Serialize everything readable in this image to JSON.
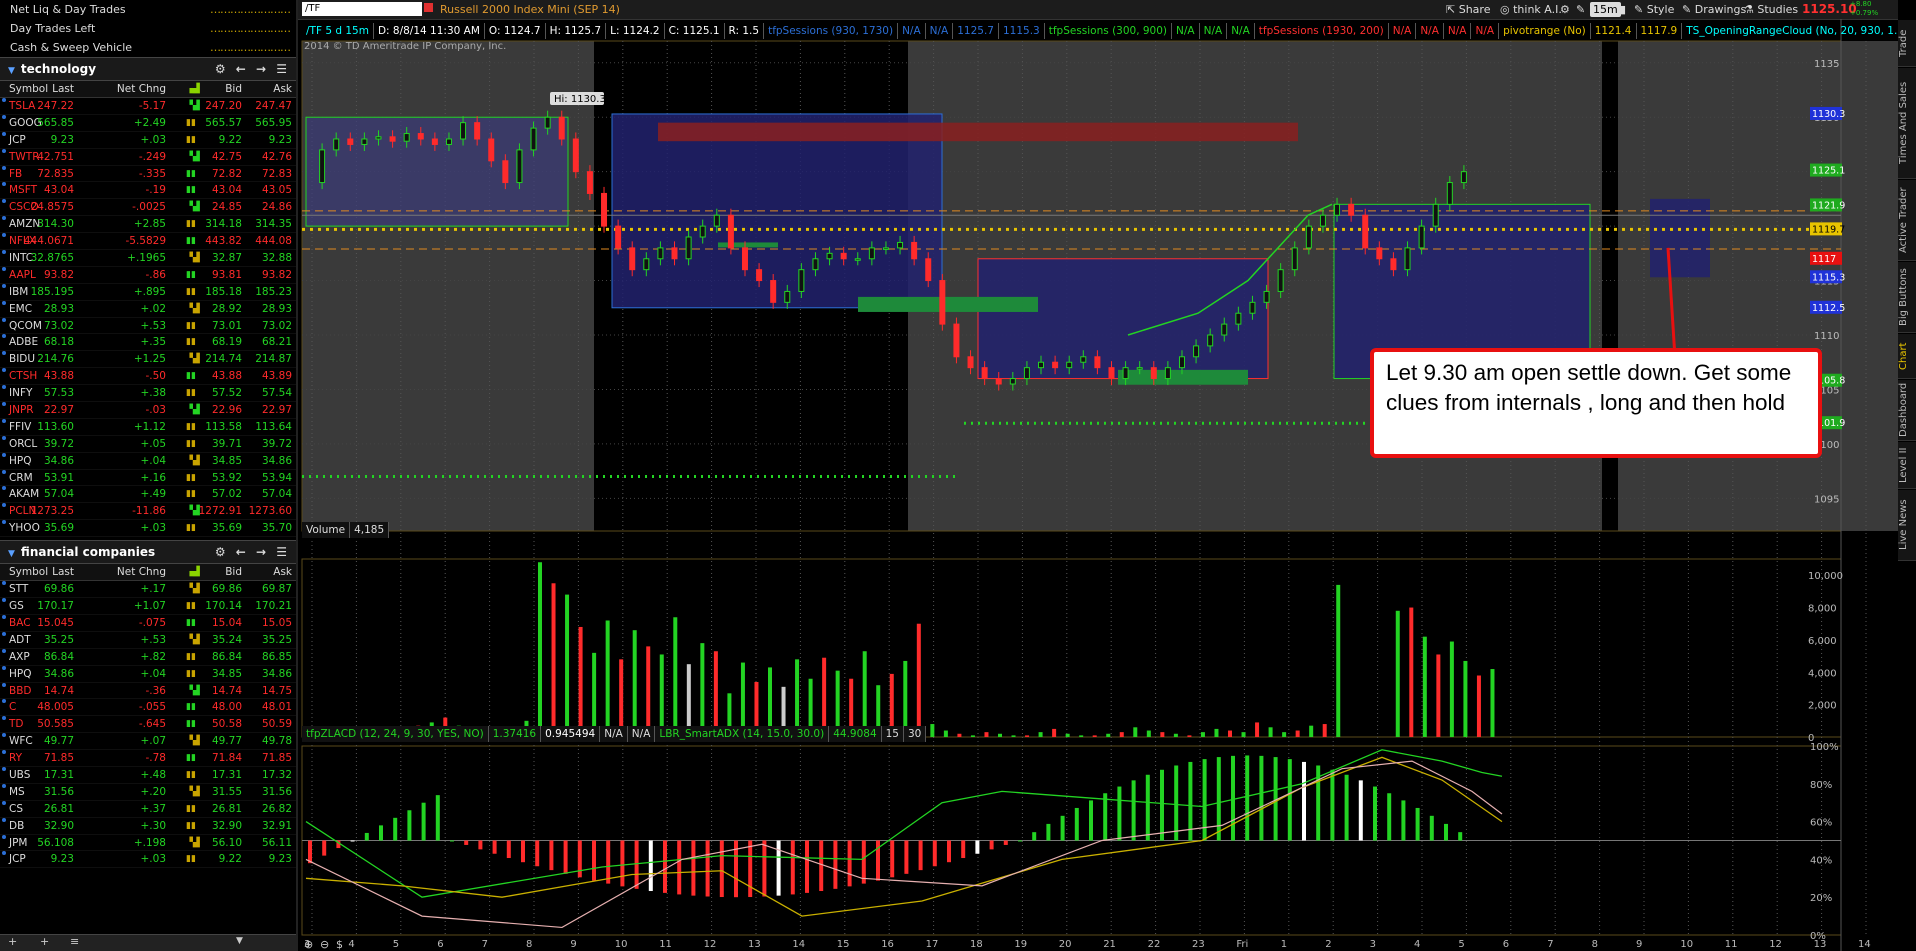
{
  "account": {
    "rows": [
      {
        "label": "Net Liq & Day Trades"
      },
      {
        "label": "Day Trades Left"
      },
      {
        "label": "Cash & Sweep Vehicle"
      }
    ]
  },
  "watchlists": [
    {
      "title": "technology",
      "columns": [
        "Symbol",
        "Last",
        "Net Chng",
        "Bid",
        "Ask"
      ],
      "rows": [
        {
          "sym": "TSLA",
          "last": "247.22",
          "chg": "-5.17",
          "bid": "247.20",
          "ask": "247.47",
          "dir": "dn"
        },
        {
          "sym": "GOOG",
          "last": "565.85",
          "chg": "+2.49",
          "bid": "565.57",
          "ask": "565.95",
          "dir": "up"
        },
        {
          "sym": "JCP",
          "last": "9.23",
          "chg": "+.03",
          "bid": "9.22",
          "ask": "9.23",
          "dir": "up"
        },
        {
          "sym": "TWTR",
          "last": "42.751",
          "chg": "-.249",
          "bid": "42.75",
          "ask": "42.76",
          "dir": "dn"
        },
        {
          "sym": "FB",
          "last": "72.835",
          "chg": "-.335",
          "bid": "72.82",
          "ask": "72.83",
          "dir": "dn"
        },
        {
          "sym": "MSFT",
          "last": "43.04",
          "chg": "-.19",
          "bid": "43.04",
          "ask": "43.05",
          "dir": "dn"
        },
        {
          "sym": "CSCO",
          "last": "24.8575",
          "chg": "-.0025",
          "bid": "24.85",
          "ask": "24.86",
          "dir": "dn"
        },
        {
          "sym": "AMZN",
          "last": "314.30",
          "chg": "+2.85",
          "bid": "314.18",
          "ask": "314.35",
          "dir": "up"
        },
        {
          "sym": "NFLX",
          "last": "444.0671",
          "chg": "-5.5829",
          "bid": "443.82",
          "ask": "444.08",
          "dir": "dn"
        },
        {
          "sym": "INTC",
          "last": "32.8765",
          "chg": "+.1965",
          "bid": "32.87",
          "ask": "32.88",
          "dir": "up"
        },
        {
          "sym": "AAPL",
          "last": "93.82",
          "chg": "-.86",
          "bid": "93.81",
          "ask": "93.82",
          "dir": "dn"
        },
        {
          "sym": "IBM",
          "last": "185.195",
          "chg": "+.895",
          "bid": "185.18",
          "ask": "185.23",
          "dir": "up"
        },
        {
          "sym": "EMC",
          "last": "28.93",
          "chg": "+.02",
          "bid": "28.92",
          "ask": "28.93",
          "dir": "up"
        },
        {
          "sym": "QCOM",
          "last": "73.02",
          "chg": "+.53",
          "bid": "73.01",
          "ask": "73.02",
          "dir": "up"
        },
        {
          "sym": "ADBE",
          "last": "68.18",
          "chg": "+.35",
          "bid": "68.19",
          "ask": "68.21",
          "dir": "up"
        },
        {
          "sym": "BIDU",
          "last": "214.76",
          "chg": "+1.25",
          "bid": "214.74",
          "ask": "214.87",
          "dir": "up"
        },
        {
          "sym": "CTSH",
          "last": "43.88",
          "chg": "-.50",
          "bid": "43.88",
          "ask": "43.89",
          "dir": "dn"
        },
        {
          "sym": "INFY",
          "last": "57.53",
          "chg": "+.38",
          "bid": "57.52",
          "ask": "57.54",
          "dir": "up"
        },
        {
          "sym": "JNPR",
          "last": "22.97",
          "chg": "-.03",
          "bid": "22.96",
          "ask": "22.97",
          "dir": "dn"
        },
        {
          "sym": "FFIV",
          "last": "113.60",
          "chg": "+1.12",
          "bid": "113.58",
          "ask": "113.64",
          "dir": "up"
        },
        {
          "sym": "ORCL",
          "last": "39.72",
          "chg": "+.05",
          "bid": "39.71",
          "ask": "39.72",
          "dir": "up"
        },
        {
          "sym": "HPQ",
          "last": "34.86",
          "chg": "+.04",
          "bid": "34.85",
          "ask": "34.86",
          "dir": "up"
        },
        {
          "sym": "CRM",
          "last": "53.91",
          "chg": "+.16",
          "bid": "53.92",
          "ask": "53.94",
          "dir": "up"
        },
        {
          "sym": "AKAM",
          "last": "57.04",
          "chg": "+.49",
          "bid": "57.02",
          "ask": "57.04",
          "dir": "up"
        },
        {
          "sym": "PCLN",
          "last": "1273.25",
          "chg": "-11.86",
          "bid": "1272.91",
          "ask": "1273.60",
          "dir": "dn"
        },
        {
          "sym": "YHOO",
          "last": "35.69",
          "chg": "+.03",
          "bid": "35.69",
          "ask": "35.70",
          "dir": "up"
        }
      ]
    },
    {
      "title": "financial companies",
      "columns": [
        "Symbol",
        "Last",
        "Net Chng",
        "Bid",
        "Ask"
      ],
      "rows": [
        {
          "sym": "STT",
          "last": "69.86",
          "chg": "+.17",
          "bid": "69.86",
          "ask": "69.87",
          "dir": "up"
        },
        {
          "sym": "GS",
          "last": "170.17",
          "chg": "+1.07",
          "bid": "170.14",
          "ask": "170.21",
          "dir": "up"
        },
        {
          "sym": "BAC",
          "last": "15.045",
          "chg": "-.075",
          "bid": "15.04",
          "ask": "15.05",
          "dir": "dn"
        },
        {
          "sym": "ADT",
          "last": "35.25",
          "chg": "+.53",
          "bid": "35.24",
          "ask": "35.25",
          "dir": "up"
        },
        {
          "sym": "AXP",
          "last": "86.84",
          "chg": "+.82",
          "bid": "86.84",
          "ask": "86.85",
          "dir": "up"
        },
        {
          "sym": "HPQ",
          "last": "34.86",
          "chg": "+.04",
          "bid": "34.85",
          "ask": "34.86",
          "dir": "up"
        },
        {
          "sym": "BBD",
          "last": "14.74",
          "chg": "-.36",
          "bid": "14.74",
          "ask": "14.75",
          "dir": "dn"
        },
        {
          "sym": "C",
          "last": "48.005",
          "chg": "-.055",
          "bid": "48.00",
          "ask": "48.01",
          "dir": "dn"
        },
        {
          "sym": "TD",
          "last": "50.585",
          "chg": "-.645",
          "bid": "50.58",
          "ask": "50.59",
          "dir": "dn"
        },
        {
          "sym": "WFC",
          "last": "49.77",
          "chg": "+.07",
          "bid": "49.77",
          "ask": "49.78",
          "dir": "up"
        },
        {
          "sym": "RY",
          "last": "71.85",
          "chg": "-.78",
          "bid": "71.84",
          "ask": "71.85",
          "dir": "dn"
        },
        {
          "sym": "UBS",
          "last": "17.31",
          "chg": "+.48",
          "bid": "17.31",
          "ask": "17.32",
          "dir": "up"
        },
        {
          "sym": "MS",
          "last": "31.56",
          "chg": "+.20",
          "bid": "31.55",
          "ask": "31.56",
          "dir": "up"
        },
        {
          "sym": "CS",
          "last": "26.81",
          "chg": "+.37",
          "bid": "26.81",
          "ask": "26.82",
          "dir": "up"
        },
        {
          "sym": "DB",
          "last": "32.90",
          "chg": "+.30",
          "bid": "32.90",
          "ask": "32.91",
          "dir": "up"
        },
        {
          "sym": "JPM",
          "last": "56.108",
          "chg": "+.198",
          "bid": "56.10",
          "ask": "56.11",
          "dir": "up"
        },
        {
          "sym": "JCP",
          "last": "9.23",
          "chg": "+.03",
          "bid": "9.22",
          "ask": "9.23",
          "dir": "up"
        }
      ]
    }
  ],
  "toolbar": {
    "symbol": "/TF",
    "description": "Russell 2000 Index Mini (SEP 14)",
    "share": "Share",
    "think_ai": "think A.I.",
    "timeframe": "15m",
    "style": "Style",
    "drawings": "Drawings",
    "studies": "Studies",
    "last_price": "1125.10",
    "change_1": "+8.80",
    "change_2": "+0.79%"
  },
  "infobar": {
    "items": [
      "/TF 5 d 15m",
      "D: 8/8/14 11:30 AM",
      "O: 1124.7",
      "H: 1125.7",
      "L: 1124.2",
      "C: 1125.1",
      "R: 1.5",
      "tfpSessions (930, 1730)",
      "N/A",
      "N/A",
      "1125.7",
      "1115.3",
      "tfpSessions (300, 900)",
      "N/A",
      "N/A",
      "N/A",
      "tfpSessions (1930, 200)",
      "N/A",
      "N/A",
      "N/A",
      "N/A",
      "pivotrange (No)",
      "1121.4",
      "1117.9",
      "TS_OpeningRangeCloud (No, 20, 930, 1..."
    ]
  },
  "copyright": "2014 © TD Ameritrade IP Company, Inc.",
  "hi_label": "Hi: 1130.3",
  "callout": "Let 9.30 am open settle down. Get some clues from internals , long and then hold",
  "price_axis": {
    "ticks": [
      "1135",
      "1130",
      "1125",
      "1120",
      "1115",
      "1110",
      "1105",
      "1100",
      "1095"
    ],
    "tags": [
      {
        "label": "1130.3",
        "color": "#2032d8"
      },
      {
        "label": "1125.1",
        "color": "#1faa1f"
      },
      {
        "label": "1121.9",
        "color": "#1faa1f"
      },
      {
        "label": "1119.7",
        "color": "#e8c400"
      },
      {
        "label": "1117",
        "color": "#e81010"
      },
      {
        "label": "1115.3",
        "color": "#2032d8"
      },
      {
        "label": "1112.5",
        "color": "#2032d8"
      },
      {
        "label": "1105.8",
        "color": "#1faa1f"
      },
      {
        "label": "1101.9",
        "color": "#1faa1f"
      }
    ]
  },
  "volume_pane": {
    "label": "Volume",
    "value": "4,185",
    "ticks": [
      "10,000",
      "8,000",
      "6,000",
      "4,000",
      "2,000",
      "0"
    ]
  },
  "indicator_pane": {
    "items": [
      "tfpZLACD (12, 24, 9, 30, YES, NO)",
      "1.37416",
      "0.945494",
      "N/A",
      "N/A",
      "LBR_SmartADX (14, 15.0, 30.0)",
      "44.9084",
      "15",
      "30"
    ],
    "ticks": [
      "100%",
      "80%",
      "60%",
      "40%",
      "20%",
      "0%"
    ]
  },
  "time_axis": [
    "3",
    "4",
    "5",
    "6",
    "7",
    "8",
    "9",
    "10",
    "11",
    "12",
    "13",
    "14",
    "15",
    "16",
    "17",
    "18",
    "19",
    "20",
    "21",
    "22",
    "23",
    "Fri",
    "1",
    "2",
    "3",
    "4",
    "5",
    "6",
    "7",
    "8",
    "9",
    "10",
    "11",
    "12",
    "13",
    "14"
  ],
  "right_tabs": [
    "Trade",
    "Times And Sales",
    "Active Trader",
    "Big Buttons",
    "Chart",
    "Dashboard",
    "Level II",
    "Live News"
  ]
}
